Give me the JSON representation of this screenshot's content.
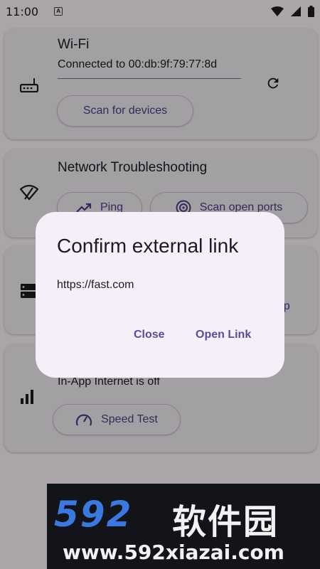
{
  "status_bar": {
    "time": "11:00",
    "notification_icon": "A",
    "icons": [
      "wifi-icon",
      "signal-icon",
      "battery-icon"
    ]
  },
  "wifi_card": {
    "title": "Wi-Fi",
    "subtitle": "Connected to 00:db:9f:79:77:8d",
    "scan_button": "Scan for devices",
    "icons": [
      "router-icon",
      "refresh-icon"
    ]
  },
  "troubleshooting_card": {
    "title": "Network Troubleshooting",
    "ping_button": "Ping",
    "scan_ports_button": "Scan open ports",
    "icons": [
      "wifi-off-icon",
      "trending-up-icon",
      "radar-icon"
    ]
  },
  "dns_card": {
    "partial_button_text": "kup",
    "icons": [
      "dns-icon"
    ]
  },
  "speed_card": {
    "subtitle": "In-App Internet is off",
    "speed_button": "Speed Test",
    "icons": [
      "signal-bars-icon",
      "speedometer-icon"
    ]
  },
  "dialog": {
    "title": "Confirm external link",
    "url": "https://fast.com",
    "close_button": "Close",
    "open_button": "Open Link"
  },
  "watermark": {
    "logo_number": "592",
    "logo_text": "软件园",
    "url": "www.592xiazai.com"
  },
  "colors": {
    "accent": "#4b3f8a",
    "dialog_bg": "#f6eef8",
    "card_bg": "#f4eff4"
  }
}
